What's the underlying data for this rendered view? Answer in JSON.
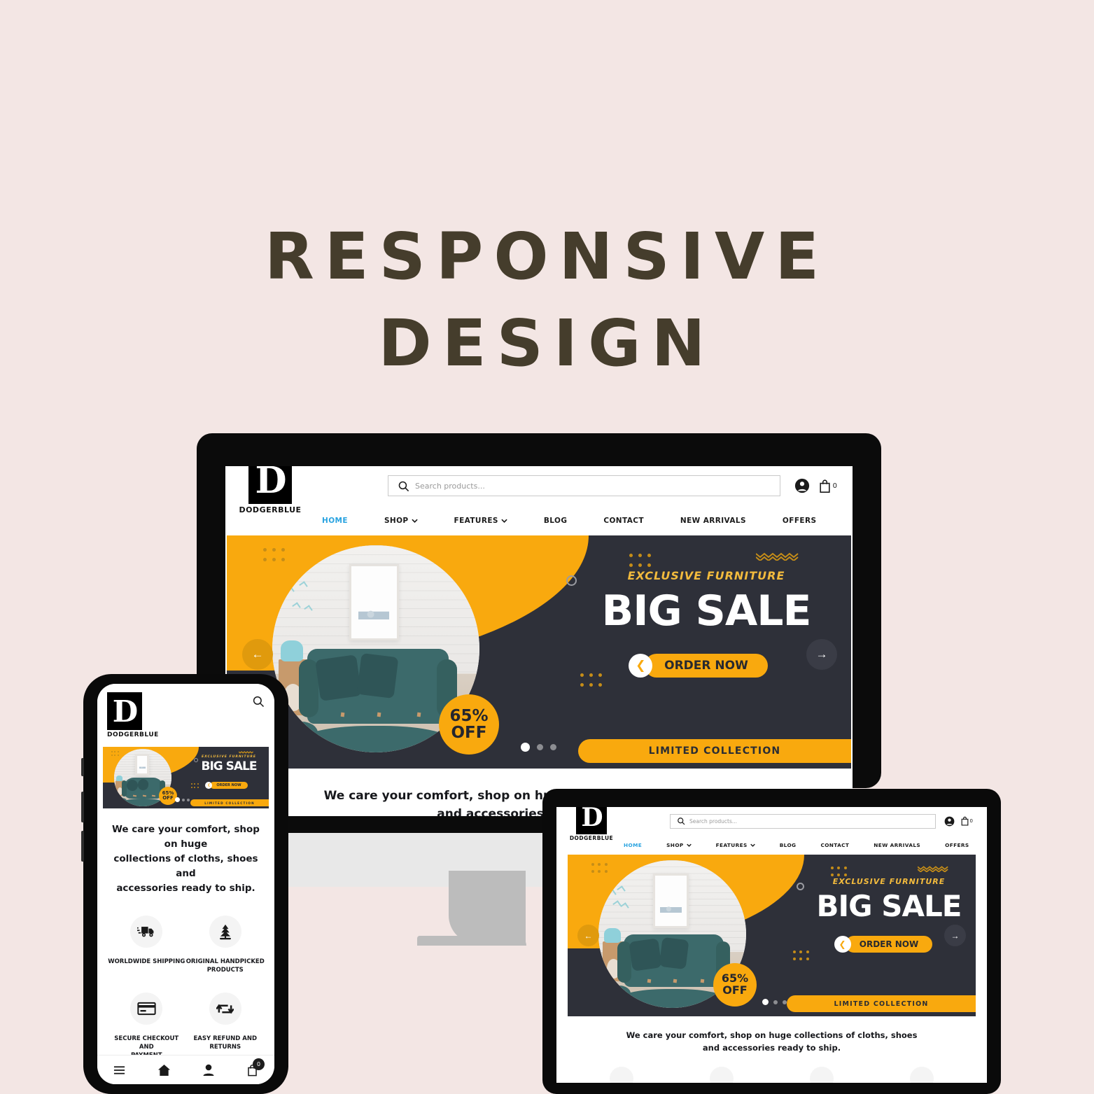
{
  "heading": {
    "line1": "RESPONSIVE",
    "line2": "DESIGN"
  },
  "colors": {
    "page_background": "#f3e6e4",
    "heading_text": "#453d2c",
    "accent_yellow": "#f9a90e",
    "hero_dark": "#2e3039",
    "nav_active_blue": "#29a3e0",
    "sofa_teal": "#3c6a6b"
  },
  "site": {
    "brand": {
      "logo_letter": "D",
      "name": "DODGERBLUE"
    },
    "search": {
      "placeholder": "Search products...",
      "icon": "search-icon"
    },
    "header_icons": {
      "account": "user-circle-icon",
      "cart": "shopping-bag-icon",
      "cart_count": "0"
    },
    "nav": [
      {
        "label": "HOME",
        "active": true,
        "has_dropdown": false
      },
      {
        "label": "SHOP",
        "active": false,
        "has_dropdown": true
      },
      {
        "label": "FEATURES",
        "active": false,
        "has_dropdown": true
      },
      {
        "label": "BLOG",
        "active": false,
        "has_dropdown": false
      },
      {
        "label": "CONTACT",
        "active": false,
        "has_dropdown": false
      },
      {
        "label": "NEW ARRIVALS",
        "active": false,
        "has_dropdown": false
      },
      {
        "label": "OFFERS",
        "active": false,
        "has_dropdown": false
      }
    ],
    "hero": {
      "kicker": "EXCLUSIVE FURNITURE",
      "title": "BIG SALE",
      "cta": "ORDER NOW",
      "cta_chevron": "❮",
      "badge_percent": "65%",
      "badge_off": "OFF",
      "ribbon": "LIMITED COLLECTION",
      "prev_arrow": "←",
      "next_arrow": "→",
      "slides_total": 3,
      "slide_active": 1
    },
    "tagline": "We care your comfort, shop on huge collections of cloths, shoes and accessories ready to ship.",
    "tagline_line1": "We care your comfort, shop on huge collections of cloths, shoes",
    "tagline_line2": "and accessories ready to ship.",
    "mobile_tagline_line1": "We care your comfort, shop on huge",
    "mobile_tagline_line2": "collections of cloths, shoes and",
    "mobile_tagline_line3": "accessories ready to ship.",
    "features": [
      {
        "icon": "delivery-truck-icon",
        "label_line1": "WORLDWIDE SHIPPING",
        "label_line2": ""
      },
      {
        "icon": "pine-tree-icon",
        "label_line1": "ORIGINAL HANDPICKED",
        "label_line2": "PRODUCTS"
      },
      {
        "icon": "credit-card-icon",
        "label_line1": "SECURE CHECKOUT AND",
        "label_line2": "PAYMENT"
      },
      {
        "icon": "refund-arrows-icon",
        "label_line1": "EASY REFUND AND",
        "label_line2": "RETURNS"
      }
    ],
    "mobile_bottom_nav": [
      {
        "icon": "hamburger-menu-icon",
        "label": ""
      },
      {
        "icon": "home-icon",
        "label": ""
      },
      {
        "icon": "person-icon",
        "label": ""
      },
      {
        "icon": "shopping-bag-icon",
        "label": "",
        "badge": "0"
      }
    ]
  },
  "devices": {
    "desktop": "desktop-monitor-mockup",
    "tablet": "tablet-mockup",
    "phone": "phone-mockup"
  }
}
